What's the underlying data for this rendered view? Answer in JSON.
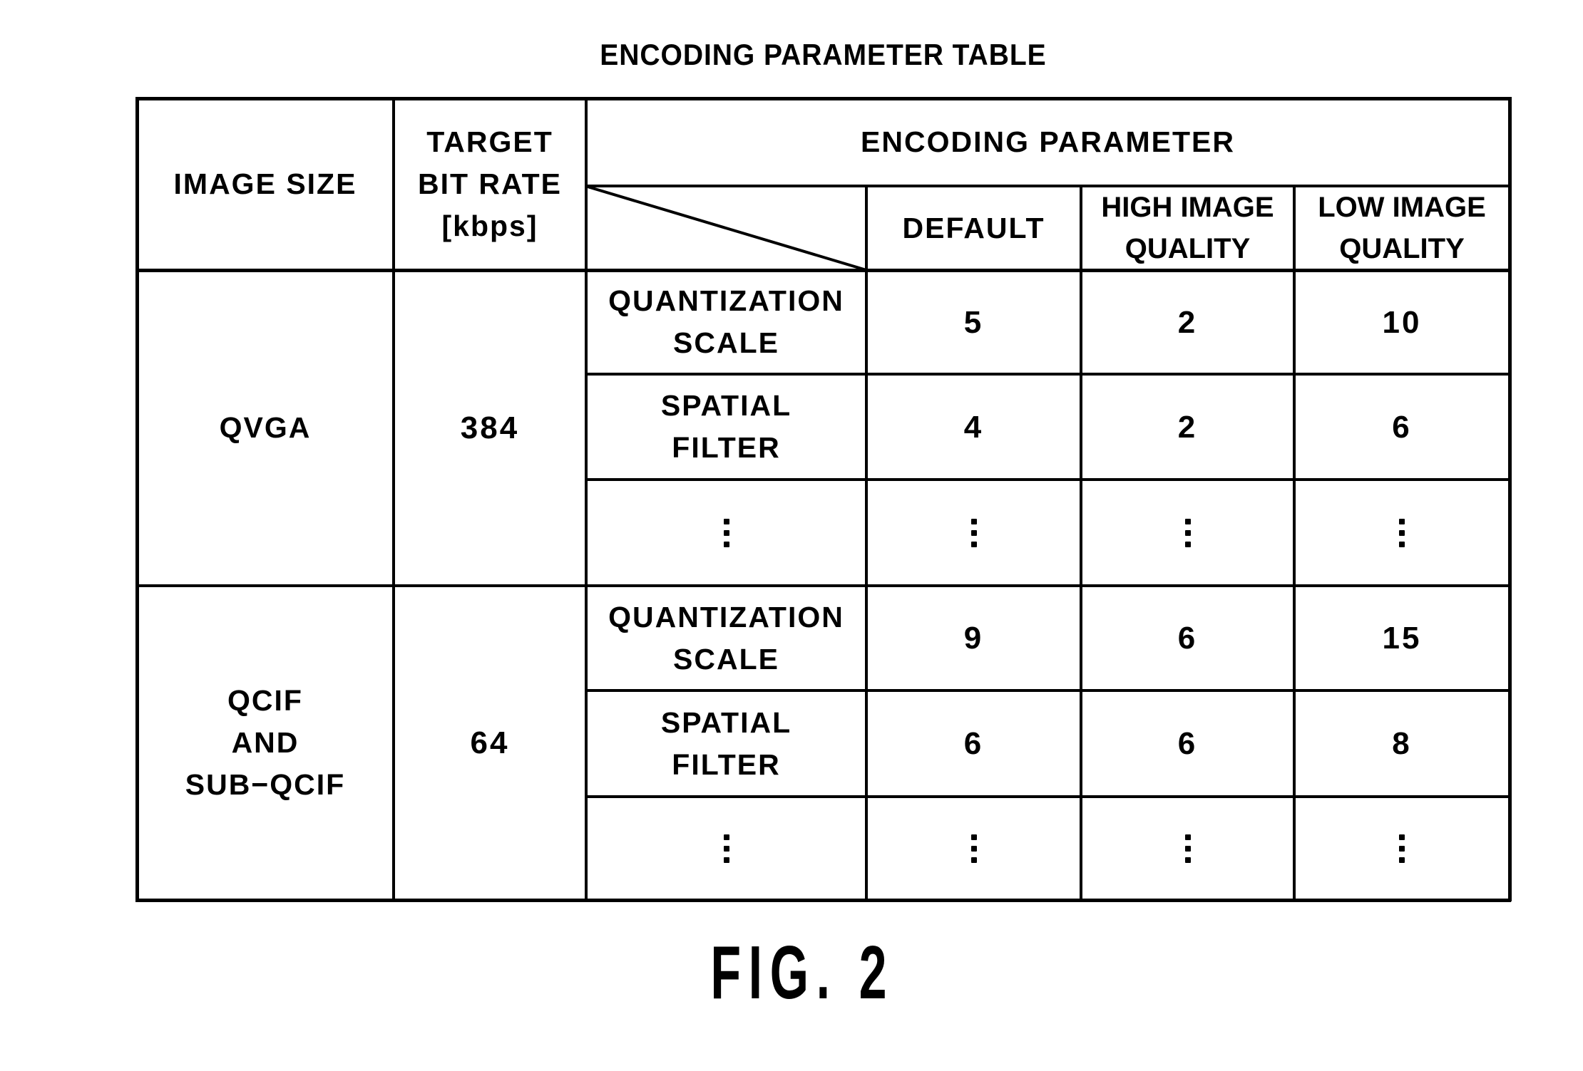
{
  "title": "ENCODING PARAMETER TABLE",
  "header": {
    "image_size": "IMAGE SIZE",
    "target_bit_rate": "TARGET\nBIT RATE\n[kbps]",
    "encoding_parameter": "ENCODING PARAMETER",
    "columns": [
      "DEFAULT",
      "HIGH IMAGE\nQUALITY",
      "LOW IMAGE\nQUALITY"
    ]
  },
  "groups": [
    {
      "image_size": "QVGA",
      "bit_rate": "384",
      "rows": [
        {
          "parameter": "QUANTIZATION\nSCALE",
          "values": [
            "5",
            "2",
            "10"
          ]
        },
        {
          "parameter": "SPATIAL\nFILTER",
          "values": [
            "4",
            "2",
            "6"
          ]
        },
        {
          "parameter": "⋮",
          "values": [
            "⋮",
            "⋮",
            "⋮"
          ]
        }
      ]
    },
    {
      "image_size": "QCIF\nAND\nSUB−QCIF",
      "bit_rate": "64",
      "rows": [
        {
          "parameter": "QUANTIZATION\nSCALE",
          "values": [
            "9",
            "6",
            "15"
          ]
        },
        {
          "parameter": "SPATIAL\nFILTER",
          "values": [
            "6",
            "6",
            "8"
          ]
        },
        {
          "parameter": "⋮",
          "values": [
            "⋮",
            "⋮",
            "⋮"
          ]
        }
      ]
    }
  ],
  "figure_label": "FIG. 2"
}
